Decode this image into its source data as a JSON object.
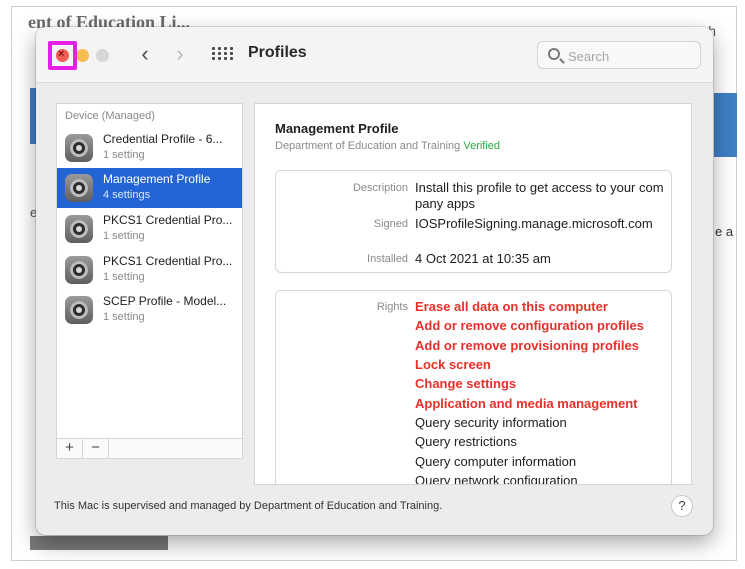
{
  "background": {
    "page_title_fragment": "ent of Education Li...",
    "search_fragment": "earch",
    "right_fragment": "e a",
    "left_fragment": "e"
  },
  "window": {
    "title": "Profiles",
    "close_glyph": "×",
    "search_placeholder": "Search",
    "nav_back": "‹",
    "nav_forward": "›"
  },
  "sidebar": {
    "header": "Device (Managed)",
    "items": [
      {
        "name": "Credential Profile - 6...",
        "sub": "1 setting",
        "selected": false
      },
      {
        "name": "Management Profile",
        "sub": "4 settings",
        "selected": true
      },
      {
        "name": "PKCS1 Credential Pro...",
        "sub": "1 setting",
        "selected": false
      },
      {
        "name": "PKCS1 Credential Pro...",
        "sub": "1 setting",
        "selected": false
      },
      {
        "name": "SCEP Profile - Model...",
        "sub": "1 setting",
        "selected": false
      }
    ],
    "add_label": "+",
    "remove_label": "−"
  },
  "detail": {
    "title": "Management Profile",
    "organization": "Department of Education and Training",
    "verified": "Verified",
    "description_label": "Description",
    "description_value": "Install this profile to get access to your company apps",
    "signed_label": "Signed",
    "signed_value": "IOSProfileSigning.manage.microsoft.com",
    "installed_label": "Installed",
    "installed_value": "4 Oct 2021 at 10:35 am",
    "rights_label": "Rights",
    "rights": [
      {
        "text": "Erase all data on this computer",
        "danger": true
      },
      {
        "text": "Add or remove configuration profiles",
        "danger": true
      },
      {
        "text": "Add or remove provisioning profiles",
        "danger": true
      },
      {
        "text": "Lock screen",
        "danger": true
      },
      {
        "text": "Change settings",
        "danger": true
      },
      {
        "text": "Application and media management",
        "danger": true
      },
      {
        "text": "Query security information",
        "danger": false
      },
      {
        "text": "Query restrictions",
        "danger": false
      },
      {
        "text": "Query computer information",
        "danger": false
      },
      {
        "text": "Query network configuration",
        "danger": false
      }
    ]
  },
  "footer": {
    "status": "This Mac is supervised and managed by Department of Education and Training.",
    "help_label": "?"
  },
  "colors": {
    "accent": "#2465d6",
    "danger": "#e8302a",
    "verified": "#2ca944",
    "highlight": "#e61ee8"
  }
}
